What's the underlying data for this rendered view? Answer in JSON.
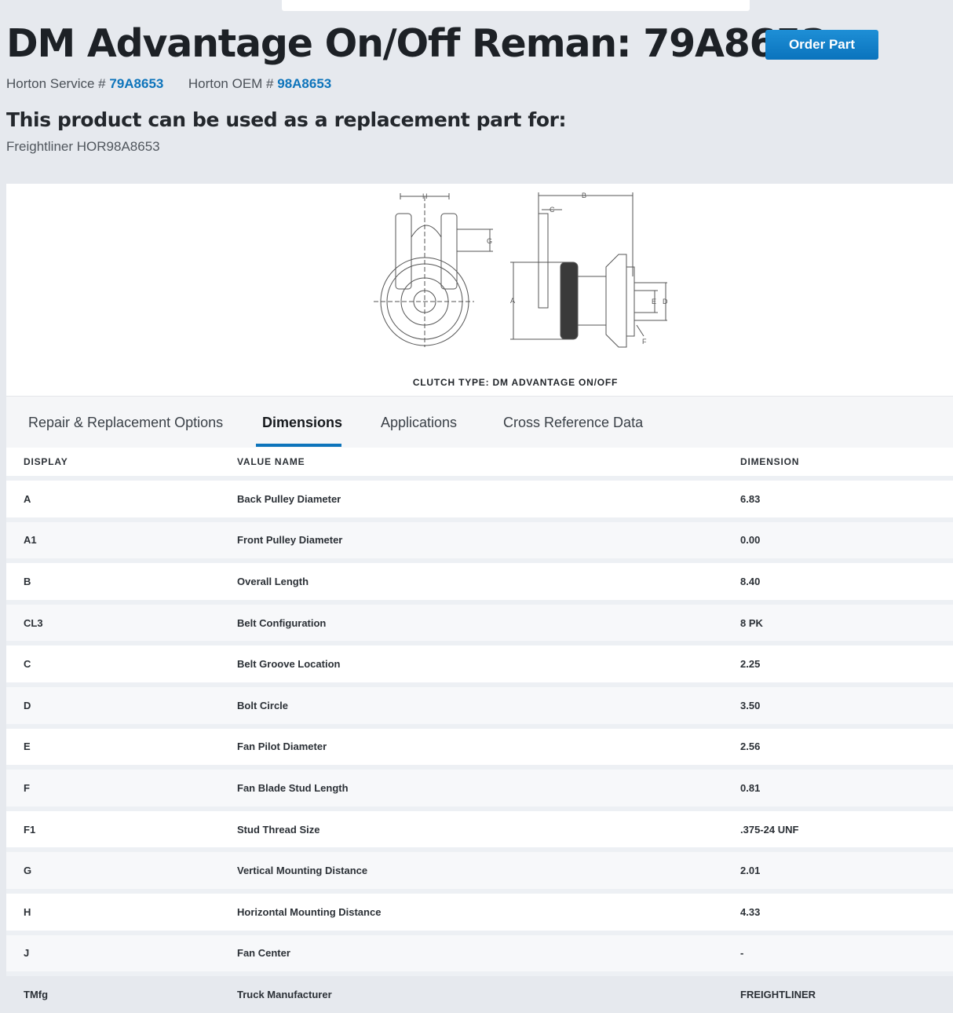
{
  "header": {
    "title": "DM Advantage On/Off Reman: 79A8653",
    "order_button": "Order Part"
  },
  "part_numbers": {
    "service_label": "Horton Service #",
    "service_value": "79A8653",
    "oem_label": "Horton OEM #",
    "oem_value": "98A8653"
  },
  "replacement": {
    "heading": "This product can be used as a replacement part for:",
    "item": "Freightliner HOR98A8653"
  },
  "diagram": {
    "caption": "CLUTCH TYPE: DM ADVANTAGE ON/OFF",
    "labels": {
      "h": "H",
      "g": "G",
      "b": "B",
      "c": "C",
      "a": "A",
      "e": "E",
      "d": "D",
      "f": "F"
    }
  },
  "tabs": [
    {
      "label": "Repair & Replacement Options",
      "active": false
    },
    {
      "label": "Dimensions",
      "active": true
    },
    {
      "label": "Applications",
      "active": false
    },
    {
      "label": "Cross Reference Data",
      "active": false
    }
  ],
  "table": {
    "headers": [
      "DISPLAY",
      "VALUE NAME",
      "DIMENSION"
    ],
    "rows": [
      [
        "A",
        "Back Pulley Diameter",
        "6.83"
      ],
      [
        "A1",
        "Front Pulley Diameter",
        "0.00"
      ],
      [
        "B",
        "Overall Length",
        "8.40"
      ],
      [
        "CL3",
        "Belt Configuration",
        "8 PK"
      ],
      [
        "C",
        "Belt Groove Location",
        "2.25"
      ],
      [
        "D",
        "Bolt Circle",
        "3.50"
      ],
      [
        "E",
        "Fan Pilot Diameter",
        "2.56"
      ],
      [
        "F",
        "Fan Blade Stud Length",
        "0.81"
      ],
      [
        "F1",
        "Stud Thread Size",
        ".375-24 UNF"
      ],
      [
        "G",
        "Vertical Mounting Distance",
        "2.01"
      ],
      [
        "H",
        "Horizontal Mounting Distance",
        "4.33"
      ],
      [
        "J",
        "Fan Center",
        "-"
      ],
      [
        "TMfg",
        "Truck Manufacturer",
        "FREIGHTLINER"
      ]
    ]
  },
  "colors": {
    "accent": "#0d74bb",
    "page_bg": "#e6e9ee"
  }
}
